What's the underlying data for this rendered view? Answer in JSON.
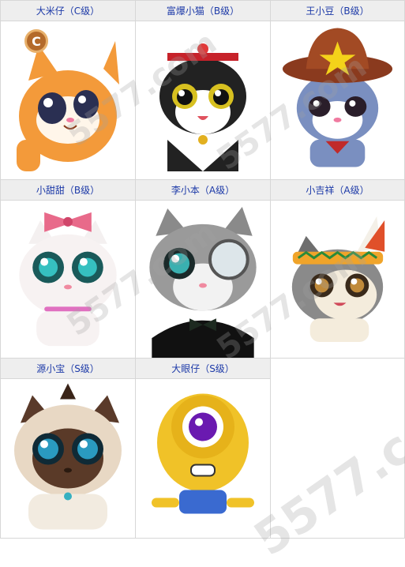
{
  "cells": [
    {
      "label": "大米仔（C级）",
      "grade": "C"
    },
    {
      "label": "富爆小猫（B级）",
      "grade": "B"
    },
    {
      "label": "王小豆（B级）",
      "grade": "B"
    },
    {
      "label": "小甜甜（B级）",
      "grade": "B"
    },
    {
      "label": "李小本（A级）",
      "grade": "A"
    },
    {
      "label": "小吉祥（A级）",
      "grade": "A"
    },
    {
      "label": "源小宝（S级）",
      "grade": "S"
    },
    {
      "label": "大眼仔（S级）",
      "grade": "S"
    }
  ],
  "badge": {
    "letter": "C"
  },
  "watermark": {
    "text": "5577.com"
  },
  "colors": {
    "header_bg": "#eeeeee",
    "header_text": "#1d3aa8",
    "border": "#d7d7d7"
  }
}
